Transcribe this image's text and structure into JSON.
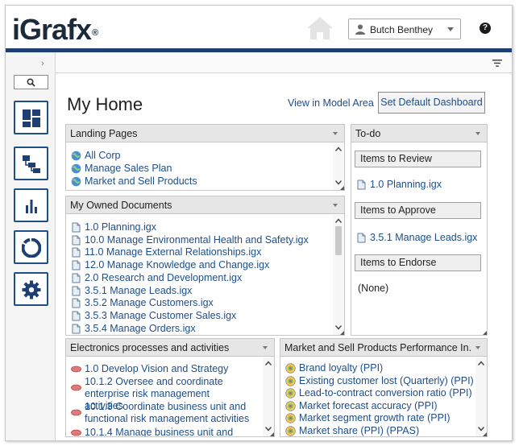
{
  "header": {
    "logo_text": "iGrafx",
    "logo_mark": "®",
    "user_name": "Butch Benthey",
    "help_label": "?"
  },
  "sidebar": {
    "collapse_label": "›",
    "nav_items": [
      {
        "name": "dashboard",
        "icon": "dashboard-icon"
      },
      {
        "name": "processes",
        "icon": "hierarchy-icon"
      },
      {
        "name": "reports",
        "icon": "bar-chart-icon"
      },
      {
        "name": "cycle",
        "icon": "ring-icon"
      },
      {
        "name": "settings",
        "icon": "gear-icon"
      }
    ]
  },
  "main": {
    "title": "My Home",
    "view_link": "View in Model Area",
    "default_button": "Set Default Dashboard"
  },
  "panels": {
    "landing": {
      "title": "Landing Pages",
      "items": [
        "All Corp",
        "Manage Sales Plan",
        "Market and Sell Products"
      ]
    },
    "owned": {
      "title": "My Owned Documents",
      "items": [
        "1.0 Planning.igx",
        "10.0 Manage Environmental Health and Safety.igx",
        "11.0 Manage External Relationships.igx",
        "12.0 Manage Knowledge and Change.igx",
        "2.0 Research and Development.igx",
        "3.5.1 Manage Leads.igx",
        "3.5.2 Manage Customers.igx",
        "3.5.3 Manage Customer Sales.igx",
        "3.5.4 Manage Orders.igx"
      ]
    },
    "todo": {
      "title": "To-do",
      "review_label": "Items to Review",
      "review_item": "1.0 Planning.igx",
      "approve_label": "Items to Approve",
      "approve_item": "3.5.1 Manage Leads.igx",
      "endorse_label": "Items to Endorse",
      "endorse_none": "(None)"
    },
    "electronics": {
      "title": "Electronics processes and activities",
      "items": [
        "1.0 Develop Vision and Strategy",
        "10.1.2 Oversee and coordinate enterprise risk management activities",
        "10.1.3 Coordinate business unit and functional risk management activities",
        "10.1.4 Manage business unit and"
      ]
    },
    "ppi": {
      "title": "Market and Sell Products Performance In...",
      "items": [
        "Brand loyalty (PPI)",
        "Existing customer lost (Quarterly) (PPI)",
        "Lead-to-contract conversion ratio (PPI)",
        "Market forecast accuracy (PPI)",
        "Market segment growth rate (PPI)",
        "Market share (PPI) (PPAS)"
      ]
    }
  },
  "colors": {
    "brand_bar": "#1e3f74",
    "link": "#1d4e89",
    "nav_border": "#1e4f86"
  }
}
